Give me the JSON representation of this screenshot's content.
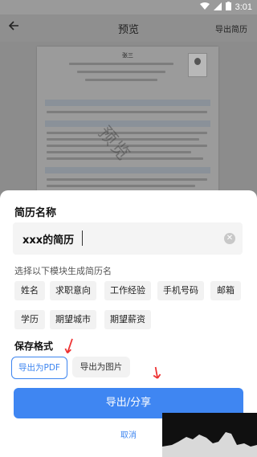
{
  "status_bar": {
    "time": "3:01"
  },
  "header": {
    "back_icon": "arrow-left-icon",
    "title": "预览",
    "export_label": "导出简历"
  },
  "preview": {
    "resume_name": "张三",
    "watermark": "预览"
  },
  "sheet": {
    "name_section_title": "简历名称",
    "name_input_value": "xxx的简历",
    "clear_icon": "clear-circle-icon",
    "modules_hint": "选择以下模块生成简历名",
    "modules": [
      "姓名",
      "求职意向",
      "工作经验",
      "手机号码",
      "邮箱",
      "学历",
      "期望城市",
      "期望薪资"
    ],
    "format_section_title": "保存格式",
    "formats": {
      "pdf": "导出为PDF",
      "image": "导出为图片"
    },
    "selected_format": "pdf",
    "primary_button": "导出/分享",
    "cancel_button": "取消"
  },
  "colors": {
    "accent": "#3f86f2",
    "annotation": "#e33333"
  }
}
